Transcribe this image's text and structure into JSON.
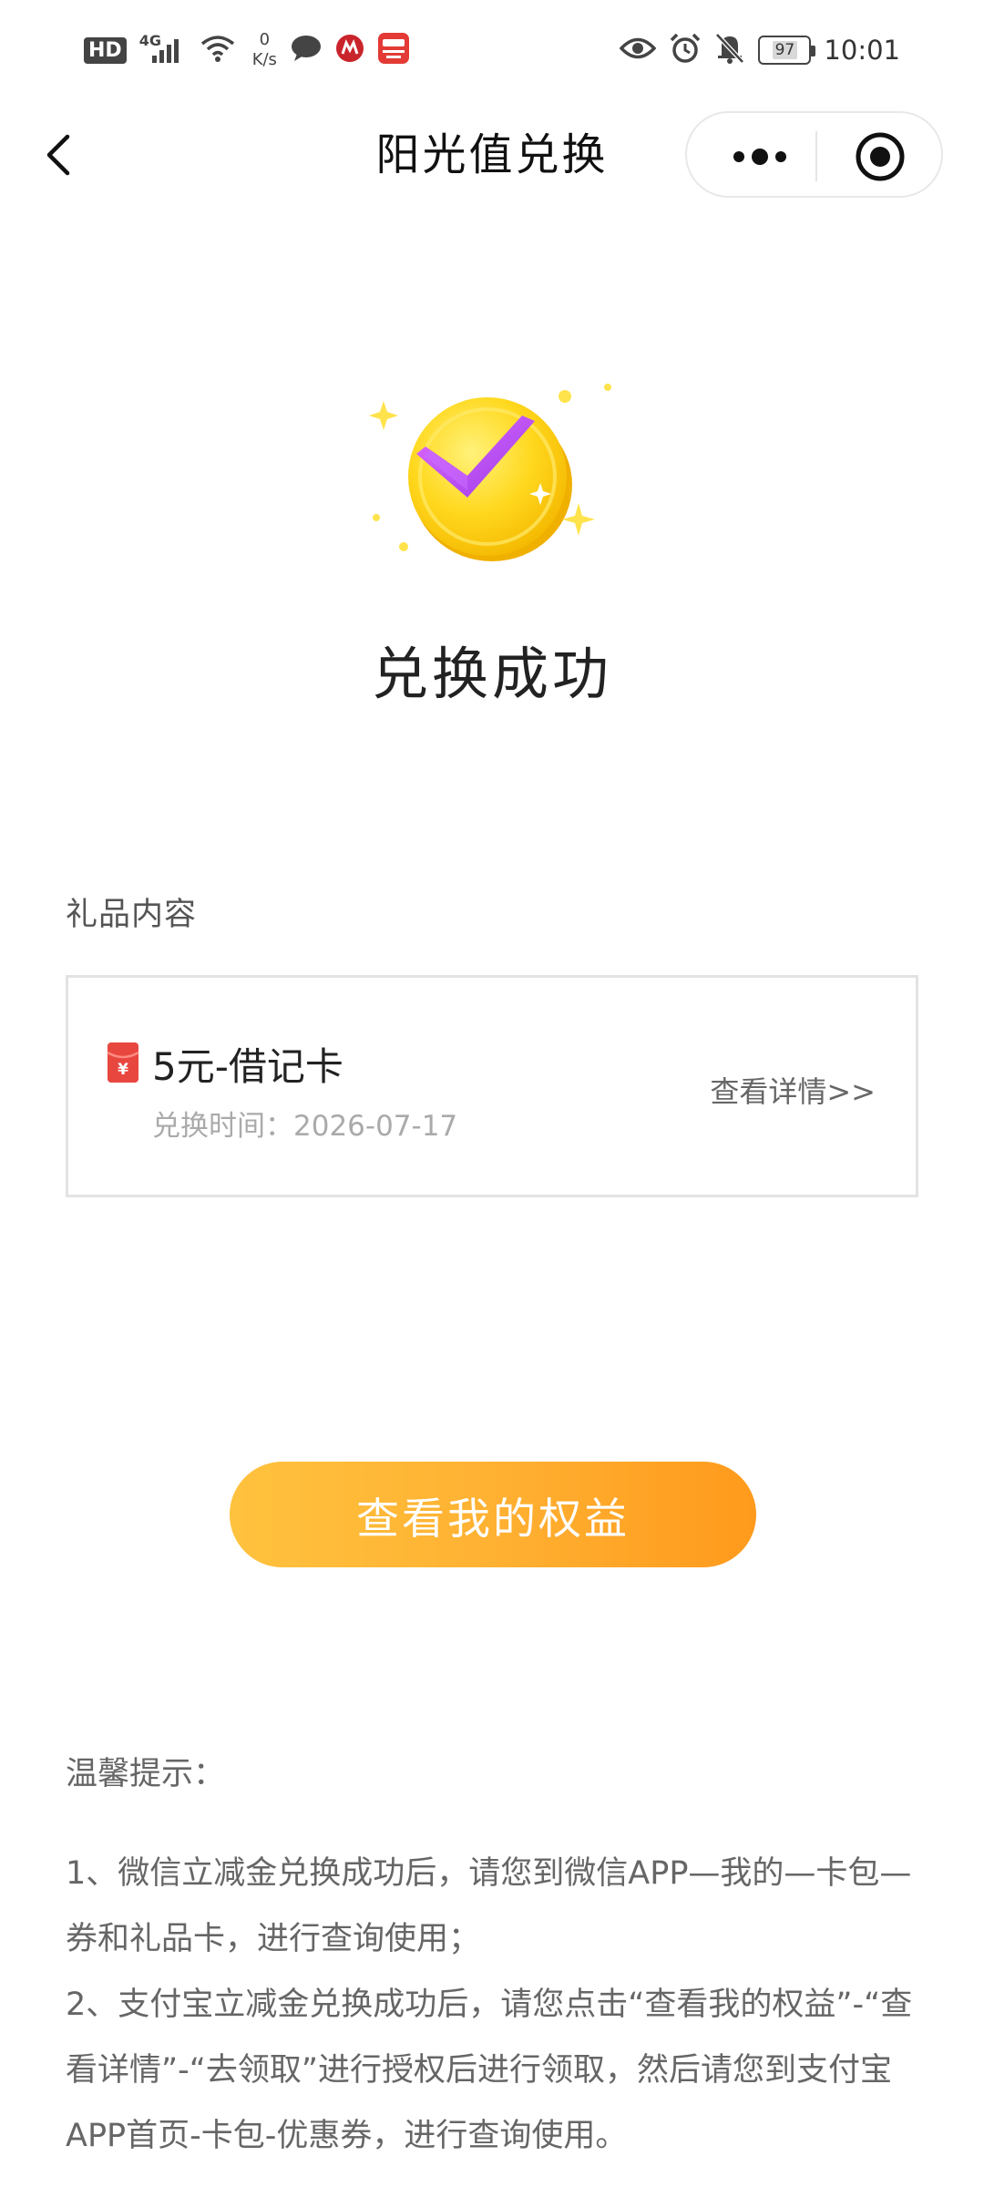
{
  "status_bar": {
    "hd": "HD",
    "network": "4G",
    "speed_value": "0",
    "speed_unit": "K/s",
    "battery": "97",
    "time": "10:01"
  },
  "nav": {
    "title": "阳光值兑换"
  },
  "success": {
    "title": "兑换成功"
  },
  "gift": {
    "section_label": "礼品内容",
    "name": "5元-借记卡",
    "time_label": "兑换时间：",
    "time_value": "2026-07-17",
    "detail_link": "查看详情>>"
  },
  "cta": {
    "label": "查看我的权益"
  },
  "tips": {
    "title": "温馨提示：",
    "line1": "1、微信立减金兑换成功后，请您到微信APP—我的—卡包—券和礼品卡，进行查询使用；",
    "line2": "2、支付宝立减金兑换成功后，请您点击“查看我的权益”-“查看详情”-“去领取”进行授权后进行领取，然后请您到支付宝APP首页-卡包-优惠券，进行查询使用。"
  },
  "colors": {
    "accent_start": "#ffc23e",
    "accent_end": "#ff9a1c",
    "gift_icon": "#e8473f",
    "check_purple": "#b84cf0"
  }
}
